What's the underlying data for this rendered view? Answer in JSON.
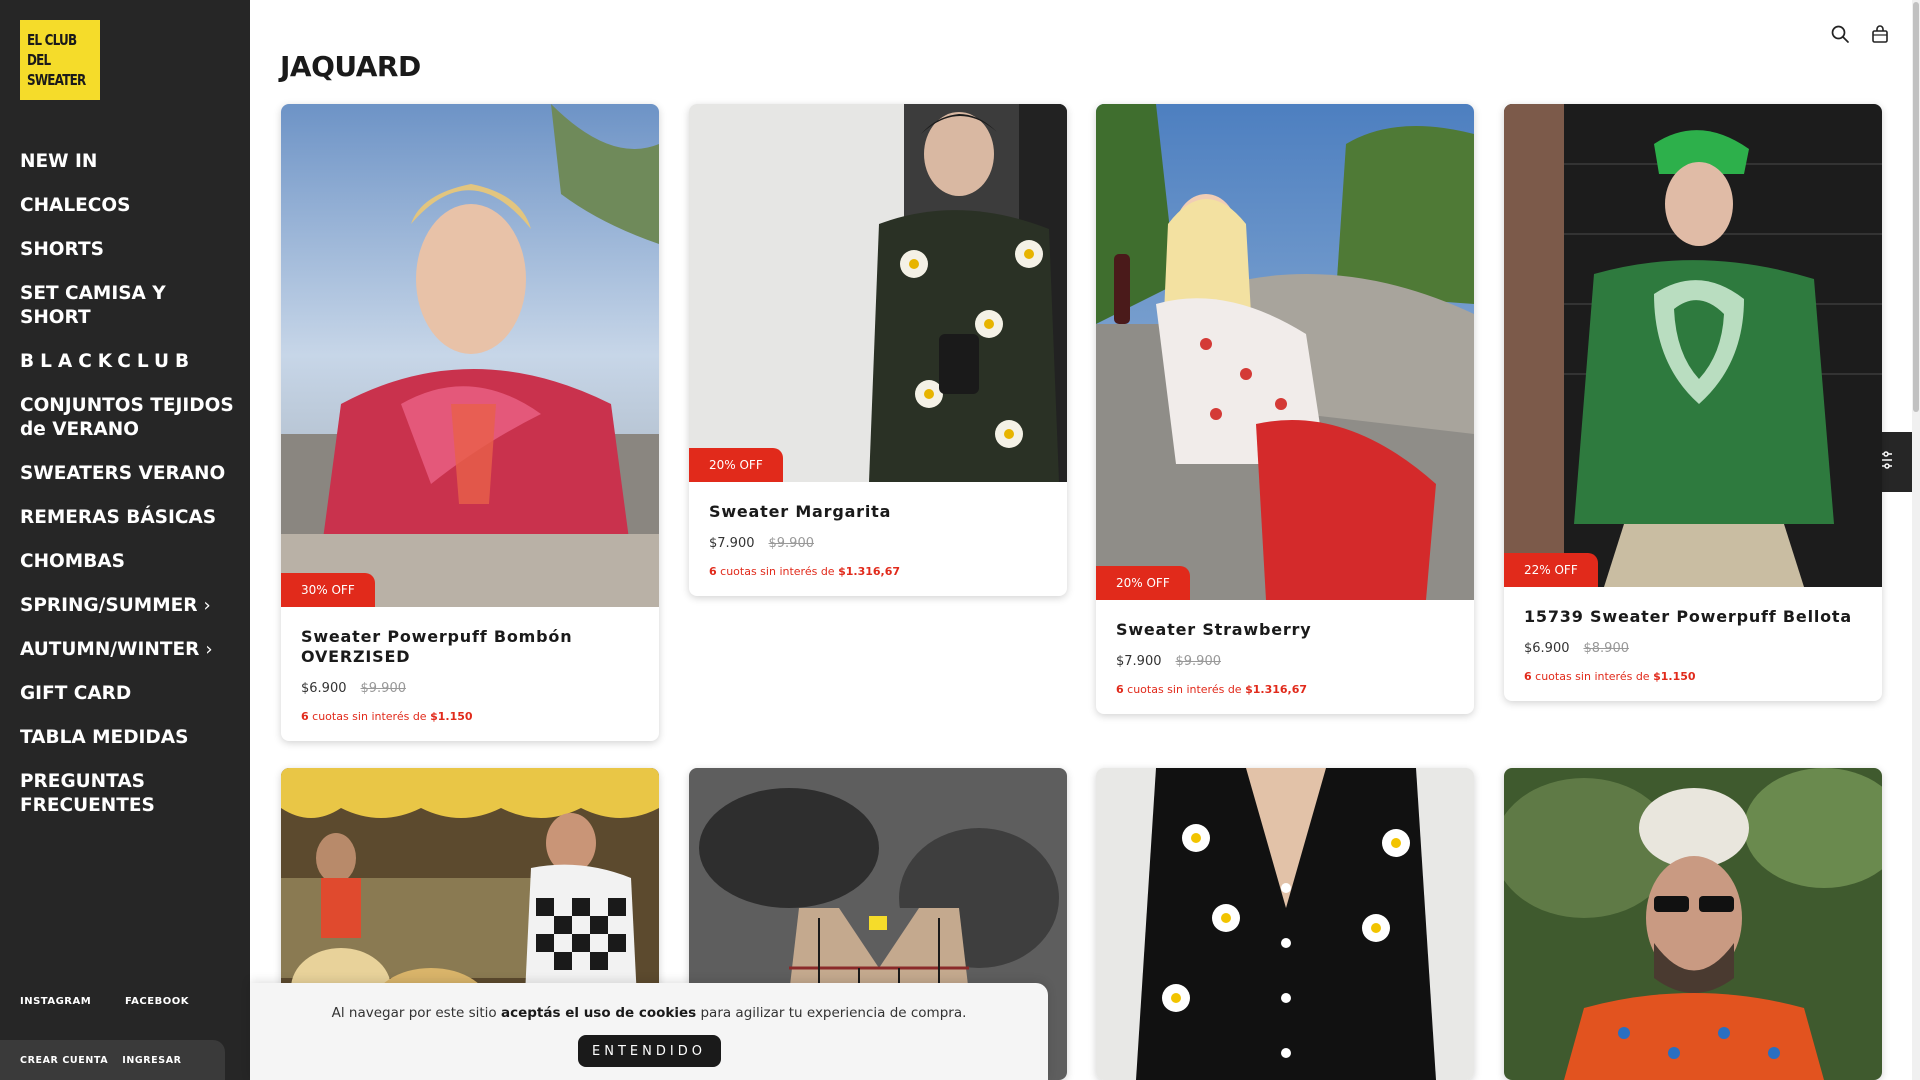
{
  "brand": {
    "logo_lines": [
      "EL CLUB",
      "DEL",
      "SWEATER"
    ],
    "logo_color": "#f5dc2a"
  },
  "sidebar": {
    "items": [
      {
        "label": "NEW IN"
      },
      {
        "label": "CHALECOS"
      },
      {
        "label": "SHORTS"
      },
      {
        "label": "SET CAMISA Y SHORT"
      },
      {
        "label": "BLACKCLUB"
      },
      {
        "label": "CONJUNTOS TEJIDOS de VERANO"
      },
      {
        "label": "SWEATERS VERANO"
      },
      {
        "label": "REMERAS BÁSICAS"
      },
      {
        "label": "CHOMBAS"
      },
      {
        "label": "SPRING/SUMMER",
        "chevron": "chevron-right-icon"
      },
      {
        "label": "AUTUMN/WINTER",
        "chevron": "chevron-right-icon"
      },
      {
        "label": "GIFT CARD"
      },
      {
        "label": "TABLA MEDIDAS"
      },
      {
        "label": "PREGUNTAS FRECUENTES"
      }
    ],
    "social": {
      "instagram": "INSTAGRAM",
      "facebook": "FACEBOOK"
    },
    "account": {
      "create": "CREAR CUENTA",
      "login": "INGRESAR"
    }
  },
  "header": {
    "title": "JAQUARD",
    "icons": [
      "search-icon",
      "bag-icon"
    ]
  },
  "filter_icon": "sliders-icon",
  "products": [
    {
      "name": "Sweater Powerpuff Bombón OVERZISED",
      "badge": "30% OFF",
      "price": "$6.900",
      "old_price": "$9.900",
      "installments_count": "6",
      "installments_text": "cuotas sin interés de",
      "installments_value": "$1.150"
    },
    {
      "name": "Sweater Margarita",
      "badge": "20% OFF",
      "price": "$7.900",
      "old_price": "$9.900",
      "installments_count": "6",
      "installments_text": "cuotas sin interés de",
      "installments_value": "$1.316,67"
    },
    {
      "name": "Sweater Strawberry",
      "badge": "20% OFF",
      "price": "$7.900",
      "old_price": "$9.900",
      "installments_count": "6",
      "installments_text": "cuotas sin interés de",
      "installments_value": "$1.316,67"
    },
    {
      "name": "15739 Sweater Powerpuff Bellota",
      "badge": "22% OFF",
      "price": "$6.900",
      "old_price": "$8.900",
      "installments_count": "6",
      "installments_text": "cuotas sin interés de",
      "installments_value": "$1.150"
    }
  ],
  "cookie": {
    "text_before": "Al navegar por este sitio ",
    "text_bold": "aceptás el uso de cookies",
    "text_after": " para agilizar tu experiencia de compra.",
    "button": "ENTENDIDO"
  },
  "colors": {
    "sidebar_bg": "#262626",
    "badge_red": "#e12a1b",
    "installments_red": "#e12a1b"
  }
}
